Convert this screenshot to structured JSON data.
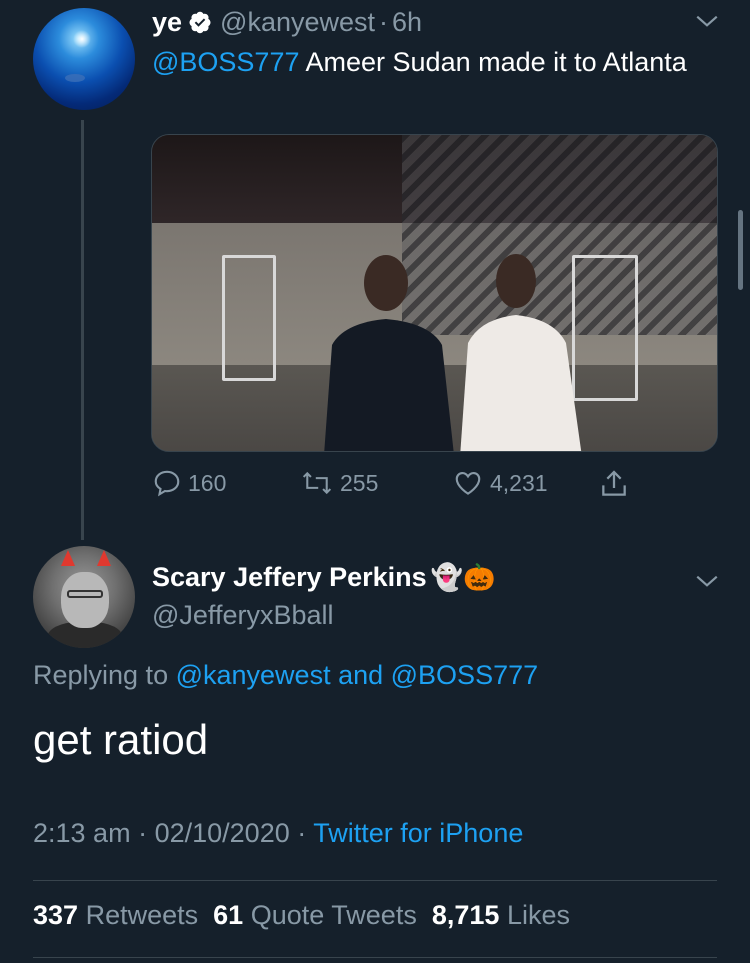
{
  "tweet": {
    "name": "ye",
    "handle": "@kanyewest",
    "separator": "·",
    "time": "6h",
    "mention": "@BOSS777",
    "text": " Ameer Sudan made it to Atlanta",
    "stats": {
      "replies": "160",
      "retweets": "255",
      "likes": "4,231"
    }
  },
  "reply": {
    "name": "Scary Jeffery Perkins",
    "name_emojis": "👻🎃",
    "handle": "@JefferyxBball",
    "replying_prefix": "Replying to ",
    "replying_user1": "@kanyewest",
    "replying_and": " and ",
    "replying_user2": "@BOSS777",
    "text": "get ratiod",
    "time": "2:13 am",
    "date": "02/10/2020",
    "meta_sep": "·",
    "source": "Twitter for iPhone",
    "retweets_count": "337",
    "retweets_label": "Retweets",
    "quotes_count": "61",
    "quotes_label": "Quote Tweets",
    "likes_count": "8,715",
    "likes_label": "Likes"
  },
  "colors": {
    "background": "#15202b",
    "accent": "#1da1f2",
    "muted": "#8899a6",
    "divider": "#38444d"
  },
  "icons": [
    "verified-badge-icon",
    "chevron-down-icon",
    "reply-icon",
    "retweet-icon",
    "heart-icon",
    "share-icon"
  ]
}
